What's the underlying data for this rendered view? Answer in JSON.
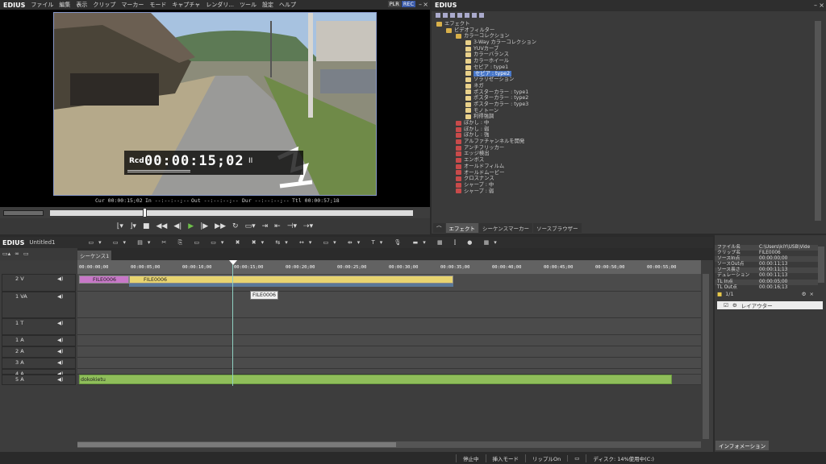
{
  "app": {
    "logo": "EDIUS",
    "menu": [
      "ファイル",
      "編集",
      "表示",
      "クリップ",
      "マーカー",
      "モード",
      "キャプチャ",
      "レンダリ...",
      "ツール",
      "設定",
      "ヘルプ"
    ],
    "plr": "PLR",
    "rec": "REC"
  },
  "viewer": {
    "rcd_label": "Rcd",
    "timecode": "00:00:15;02",
    "pause_glyph": "II",
    "cur": "Cur 00:00:15;02",
    "in": "In --:--:--;--",
    "out": "Out --:--:--;--",
    "dur": "Dur --:--:--;--",
    "ttl": "Ttl 00:00:57;18"
  },
  "effects": {
    "title": "EDIUS",
    "tree": [
      {
        "label": "エフェクト",
        "indent": 0,
        "type": "folder"
      },
      {
        "label": "ビデオフィルター",
        "indent": 1,
        "type": "folder"
      },
      {
        "label": "カラーコレクション",
        "indent": 2,
        "type": "folder"
      },
      {
        "label": "3-Way カラーコレクション",
        "indent": 3,
        "type": "item"
      },
      {
        "label": "YUVカーブ",
        "indent": 3,
        "type": "item"
      },
      {
        "label": "カラーバランス",
        "indent": 3,
        "type": "item"
      },
      {
        "label": "カラーホイール",
        "indent": 3,
        "type": "item"
      },
      {
        "label": "セピア : type1",
        "indent": 3,
        "type": "item"
      },
      {
        "label": "セピア : type2",
        "indent": 3,
        "type": "item",
        "selected": true
      },
      {
        "label": "ソラリゼーション",
        "indent": 3,
        "type": "item"
      },
      {
        "label": "ネガ",
        "indent": 3,
        "type": "item"
      },
      {
        "label": "ポスターカラー : type1",
        "indent": 3,
        "type": "item"
      },
      {
        "label": "ポスターカラー : type2",
        "indent": 3,
        "type": "item"
      },
      {
        "label": "ポスターカラー : type3",
        "indent": 3,
        "type": "item"
      },
      {
        "label": "モノトーン",
        "indent": 3,
        "type": "item"
      },
      {
        "label": "利得強調",
        "indent": 3,
        "type": "item"
      },
      {
        "label": "ぼかし : 中",
        "indent": 2,
        "type": "fx"
      },
      {
        "label": "ぼかし : 弱",
        "indent": 2,
        "type": "fx"
      },
      {
        "label": "ぼかし : 強",
        "indent": 2,
        "type": "fx"
      },
      {
        "label": "アルファチャンネルを開発",
        "indent": 2,
        "type": "fx"
      },
      {
        "label": "アンチフリッカー",
        "indent": 2,
        "type": "fx"
      },
      {
        "label": "エッジ検出",
        "indent": 2,
        "type": "fx"
      },
      {
        "label": "エンボス",
        "indent": 2,
        "type": "fx"
      },
      {
        "label": "オールドフィルム",
        "indent": 2,
        "type": "fx"
      },
      {
        "label": "オールドムービー",
        "indent": 2,
        "type": "fx"
      },
      {
        "label": "クロスナンス",
        "indent": 2,
        "type": "fx"
      },
      {
        "label": "シャープ : 中",
        "indent": 2,
        "type": "fx"
      },
      {
        "label": "シャープ : 弱",
        "indent": 2,
        "type": "fx"
      }
    ],
    "tabs": [
      "エフェクト",
      "シーケンスマーカー",
      "ソースブラウザー"
    ]
  },
  "project": {
    "logo": "EDIUS",
    "name": "Untitled1",
    "sequence_tab": "シーケンス1"
  },
  "ruler_ticks": [
    "00:00:00;00",
    "00:00:05;00",
    "00:00:10;00",
    "00:00:15;00",
    "00:00:20;00",
    "00:00:25;00",
    "00:00:30;00",
    "00:00:35;00",
    "00:00:40;00",
    "00:00:45;00",
    "00:00:50;00",
    "00:00:55;00"
  ],
  "tracks": [
    {
      "label": "2 V"
    },
    {
      "label": "1 VA"
    },
    {
      "label": "1 T"
    },
    {
      "label": "1 A"
    },
    {
      "label": "2 A"
    },
    {
      "label": "3 A"
    },
    {
      "label": "4 A"
    },
    {
      "label": "5 A"
    }
  ],
  "clips": {
    "v2_a": "FILE0006",
    "v2_b": "FILE0006",
    "audio": "dokokietu",
    "tooltip": "FILE0006"
  },
  "status": {
    "stop": "停止中",
    "mode": "挿入モード",
    "ripple": "リップルOn",
    "disk": "ディスク: 14%使用中(C:)"
  },
  "info": {
    "rows": [
      {
        "k": "ファイル名",
        "v": "C:\\Users\\kiY\\USB\\Vide"
      },
      {
        "k": "クリップ名",
        "v": "FILE0006"
      },
      {
        "k": "ソースIn点",
        "v": "00:00:00;00"
      },
      {
        "k": "ソースOut点",
        "v": "00:00:11;13"
      },
      {
        "k": "ソース長さ",
        "v": "00:00:11;13"
      },
      {
        "k": "デュレーション",
        "v": "00:00:11;13"
      },
      {
        "k": "TL In点",
        "v": "00:00:05;00"
      },
      {
        "k": "TL Out点",
        "v": "00:00:16;13"
      }
    ],
    "layer_count": "1/1",
    "layer_name": "レイアウター",
    "tab": "インフォメーション"
  },
  "colors": {
    "clip_yellow": "#e8d470",
    "clip_magenta": "#c878c8",
    "audio_green": "#8fbe5a",
    "selection": "#4a78c8"
  }
}
